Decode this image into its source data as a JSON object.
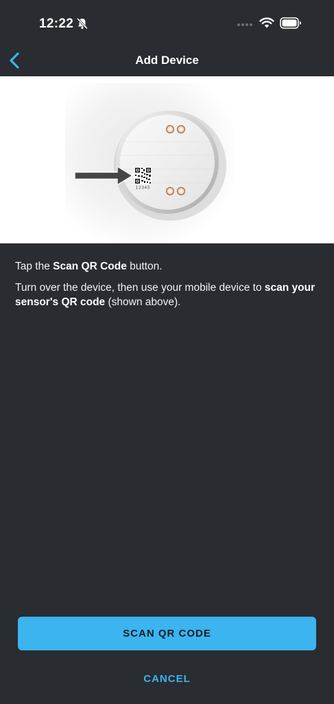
{
  "status_bar": {
    "time": "12:22",
    "icons": [
      "bell-slash-icon",
      "signal-dots-icon",
      "wifi-icon",
      "battery-icon"
    ]
  },
  "nav": {
    "title": "Add Device",
    "back_icon": "chevron-left-icon"
  },
  "hero": {
    "image": "sensor-qr-location-illustration",
    "qr_serial": "12345"
  },
  "instructions": {
    "line1": {
      "pre": "Tap the ",
      "bold": "Scan QR Code",
      "post": " button."
    },
    "line2": {
      "pre": "Turn over the device, then use your mobile device to ",
      "bold": "scan your sensor's QR code",
      "post": " (shown above)."
    }
  },
  "actions": {
    "scan_label": "SCAN QR CODE",
    "cancel_label": "CANCEL"
  },
  "colors": {
    "background": "#292c30",
    "accent": "#3bb4ef",
    "button_text": "#1a1d21"
  }
}
